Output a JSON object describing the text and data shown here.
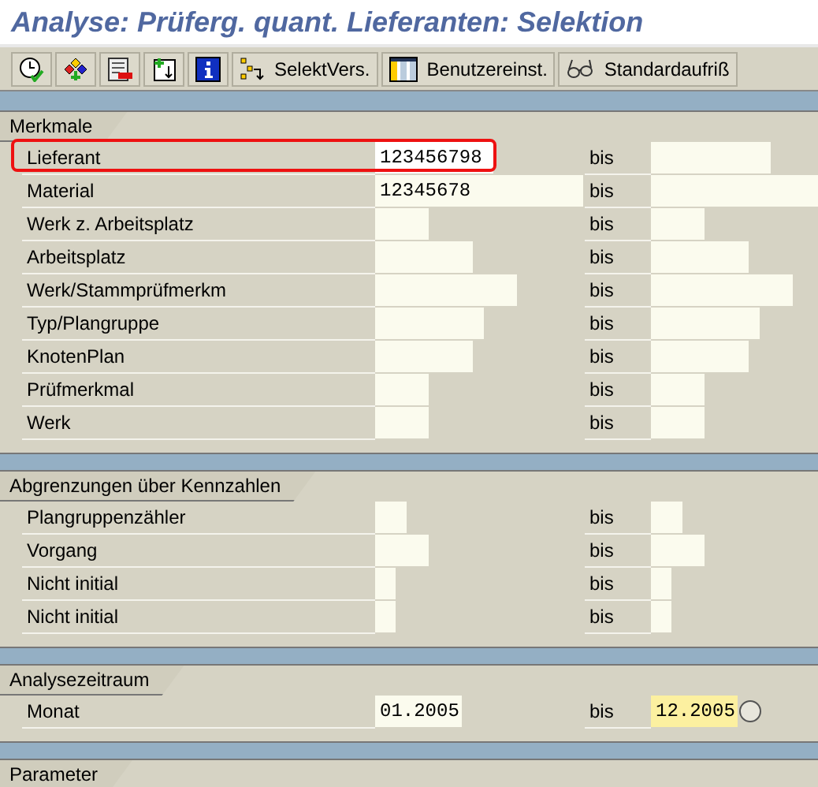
{
  "window": {
    "title": "Analyse: Prüferg. quant. Lieferanten: Selektion"
  },
  "toolbar": [
    {
      "kind": "clock-check"
    },
    {
      "kind": "nodes"
    },
    {
      "kind": "list-minus"
    },
    {
      "kind": "doc-plus"
    },
    {
      "kind": "info"
    },
    {
      "kind": "tree",
      "label": "SelektVers."
    },
    {
      "kind": "columns",
      "label": "Benutzereinst."
    },
    {
      "kind": "glasses",
      "label": "Standardaufriß"
    }
  ],
  "groups": [
    {
      "title": "Merkmale",
      "rows": [
        {
          "label": "Lieferant",
          "low": "123456798",
          "high": "",
          "between": "bis",
          "highlighted": true,
          "high_focused": false
        },
        {
          "label": "Material",
          "low": "12345678",
          "high": "",
          "between": "bis",
          "highlighted": false,
          "high_focused": false
        },
        {
          "label": "Werk z. Arbeitsplatz",
          "low": "",
          "high": "",
          "between": "bis",
          "highlighted": false,
          "high_focused": false
        },
        {
          "label": "Arbeitsplatz",
          "low": "",
          "high": "",
          "between": "bis",
          "highlighted": false,
          "high_focused": false
        },
        {
          "label": "Werk/Stammprüfmerkm",
          "low": "",
          "high": "",
          "between": "bis",
          "highlighted": false,
          "high_focused": false
        },
        {
          "label": "Typ/Plangruppe",
          "low": "",
          "high": "",
          "between": "bis",
          "highlighted": false,
          "high_focused": false
        },
        {
          "label": "KnotenPlan",
          "low": "",
          "high": "",
          "between": "bis",
          "highlighted": false,
          "high_focused": false
        },
        {
          "label": "Prüfmerkmal",
          "low": "",
          "high": "",
          "between": "bis",
          "highlighted": false,
          "high_focused": false
        },
        {
          "label": "Werk",
          "low": "",
          "high": "",
          "between": "bis",
          "highlighted": false,
          "high_focused": false
        }
      ]
    },
    {
      "title": "Abgrenzungen über Kennzahlen",
      "rows": [
        {
          "label": "Plangruppenzähler",
          "low": "",
          "high": "",
          "between": "bis",
          "highlighted": false,
          "high_focused": false
        },
        {
          "label": "Vorgang",
          "low": "",
          "high": "",
          "between": "bis",
          "highlighted": false,
          "high_focused": false
        },
        {
          "label": "Nicht initial",
          "low": "",
          "high": "",
          "between": "bis",
          "highlighted": false,
          "high_focused": false
        },
        {
          "label": "Nicht initial",
          "low": "",
          "high": "",
          "between": "bis",
          "highlighted": false,
          "high_focused": false
        }
      ]
    },
    {
      "title": "Analysezeitraum",
      "rows": [
        {
          "label": "Monat",
          "low": "01.2005",
          "high": "12.2005",
          "between": "bis",
          "highlighted": false,
          "high_focused": true,
          "kind": "multi"
        }
      ]
    },
    {
      "title": "Parameter"
    }
  ]
}
